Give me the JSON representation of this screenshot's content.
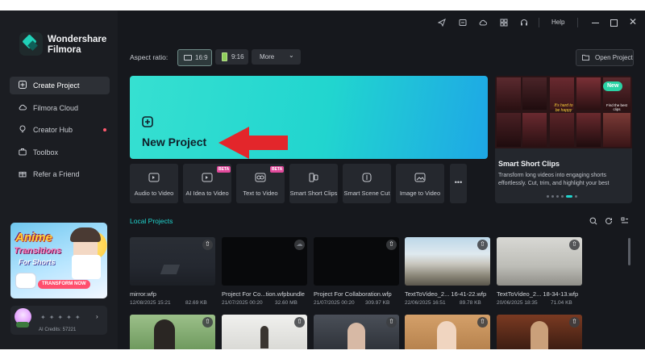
{
  "app": {
    "brand_line1": "Wondershare",
    "brand_line2": "Filmora"
  },
  "sidebar": {
    "items": [
      {
        "label": "Create Project",
        "icon": "plus-square-icon",
        "active": true
      },
      {
        "label": "Filmora Cloud",
        "icon": "cloud-icon"
      },
      {
        "label": "Creator Hub",
        "icon": "lightbulb-icon",
        "badge_dot": true
      },
      {
        "label": "Toolbox",
        "icon": "toolbox-icon"
      },
      {
        "label": "Refer a Friend",
        "icon": "gift-icon"
      }
    ],
    "promo": {
      "line1": "Anime",
      "line2": "Transitions",
      "line3": "For Shorts",
      "button": "TRANSFORM NOW"
    },
    "user": {
      "credits": "AI Credits: 57221"
    }
  },
  "topbar": {
    "icons": [
      "send-icon",
      "media-icon",
      "cloud-upload-icon",
      "grid-icon",
      "headset-icon"
    ],
    "help": "Help",
    "window_icons": [
      "minimize-icon",
      "restore-icon",
      "close-icon"
    ]
  },
  "aspect": {
    "label": "Aspect ratio:",
    "options": [
      "16:9",
      "9:16"
    ],
    "selected": "16:9",
    "more": "More",
    "open_project": "Open Project"
  },
  "new_project": {
    "label": "New Project",
    "arrow_color": "#e3262b"
  },
  "tools": [
    {
      "label": "Audio to Video",
      "beta": false
    },
    {
      "label": "AI Idea to Video",
      "beta": true
    },
    {
      "label": "Text to Video",
      "beta": true
    },
    {
      "label": "Smart Short Clips",
      "beta": false
    },
    {
      "label": "Smart Scene Cut",
      "beta": false
    },
    {
      "label": "Image to Video",
      "beta": false
    }
  ],
  "beta_label": "BETA",
  "smart_clips": {
    "badge": "New",
    "title": "Smart Short Clips",
    "description_line1": "Transform long videos into engaging shorts",
    "description_line2": "effortlessly. Cut, trim, and highlight your best",
    "thumbnail_caption1": "It's hard to be happy",
    "thumbnail_caption2": "Find the best clips",
    "carousel_count": 6,
    "carousel_active": 5
  },
  "local_projects": {
    "title": "Local Projects",
    "items": [
      {
        "name": "mirror.wfp",
        "date": "12/08/2025 15:21",
        "size": "82.69 KB"
      },
      {
        "name": "Project For Co...tion.wfpbundle",
        "date": "21/07/2025 00:20",
        "size": "32.60 MB"
      },
      {
        "name": "Project For Collaboration.wfp",
        "date": "21/07/2025 00:20",
        "size": "309.97 KB"
      },
      {
        "name": "TextToVideo_2... 16-41-22.wfp",
        "date": "22/06/2025 16:51",
        "size": "89.78 KB"
      },
      {
        "name": "TextToVideo_2... 18-34-13.wfp",
        "date": "20/06/2025 18:35",
        "size": "71.04 KB"
      }
    ]
  },
  "colors": {
    "accent": "#21d5cf",
    "background": "#16181d",
    "sidebar": "#1b1d22"
  }
}
